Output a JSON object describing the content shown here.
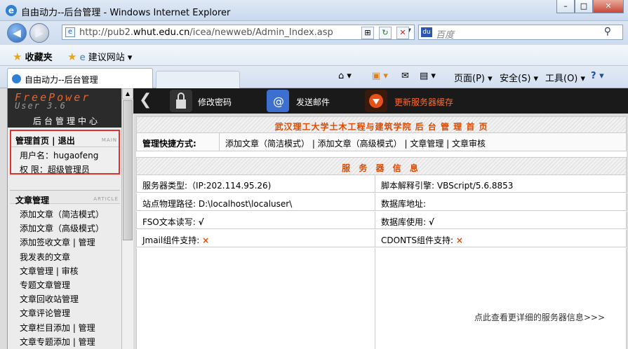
{
  "window": {
    "title": "自由动力--后台管理 - Windows Internet Explorer",
    "min": "–",
    "max": "□",
    "close": "✕"
  },
  "address": {
    "url_prefix": "http://pub2.",
    "url_host": "whut.edu.cn",
    "url_path": "/icea/newweb/Admin_Index.asp"
  },
  "search": {
    "placeholder": "百度"
  },
  "favorites": {
    "label": "收藏夹",
    "link": "建议网站 ▾"
  },
  "tab": {
    "label": "自由动力--后台管理"
  },
  "commands": {
    "page": "页面(P) ▾",
    "safety": "安全(S) ▾",
    "tools": "工具(O) ▾",
    "help": "? ▾"
  },
  "logo": {
    "line1": "FreePower",
    "line2": "User 3.6",
    "line3": "后台管理中心"
  },
  "userbox": {
    "header": "管理首页 | 退出",
    "header_en": "MAIN",
    "username": "用户名：hugaofeng",
    "role": "权  限：超级管理员"
  },
  "section": {
    "title": "文章管理",
    "title_en": "ARTICLE"
  },
  "menu": [
    "添加文章（简洁模式）",
    "添加文章（高级模式）",
    "添加签收文章 | 管理",
    "我发表的文章",
    "文章管理 | 审核",
    "专题文章管理",
    "文章回收站管理",
    "文章评论管理",
    "文章栏目添加 | 管理",
    "文章专题添加 | 管理"
  ],
  "toolbar": {
    "change_pwd": "修改密码",
    "send_mail": "发送邮件",
    "update_cache": "更新服务器缓存"
  },
  "content": {
    "heading": "武汉理工大学土木工程与建筑学院 后 台 管 理 首 页",
    "shortcut_label": "管理快捷方式:",
    "shortcuts": "添加文章（简洁模式） | 添加文章（高级模式） | 文章管理 | 文章审核",
    "server_heading": "服 务 器 信 息",
    "server_type": "服务器类型:（IP:202.114.95.26)",
    "script_engine": "脚本解释引擎: VBScript/5.6.8853",
    "site_path": "站点物理路径: D:\\localhost\\localuser\\",
    "db_addr": "数据库地址:",
    "fso_label": "FSO文本读写:",
    "fso_val": "√",
    "db_use_label": "数据库使用:",
    "db_use_val": "√",
    "jmail_label": "Jmail组件支持:",
    "jmail_val": "×",
    "cdonts_label": "CDONTS组件支持:",
    "cdonts_val": "×",
    "more": "点此查看更详细的服务器信息>>>"
  }
}
